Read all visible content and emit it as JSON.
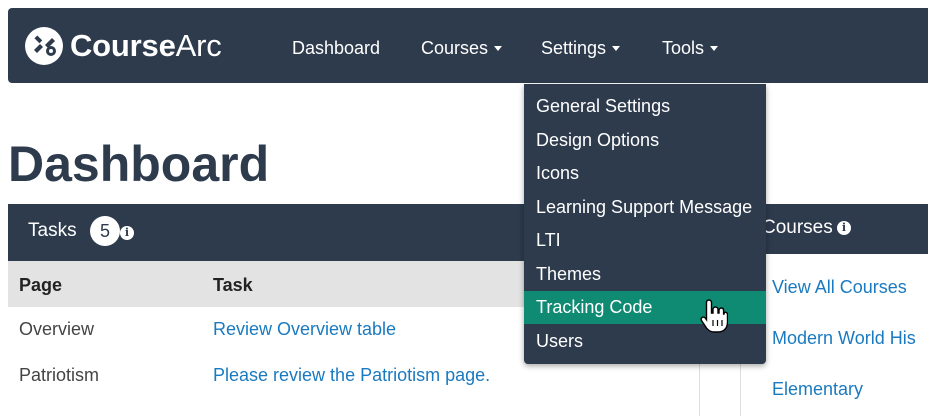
{
  "navbar": {
    "brand_bold": "Course",
    "brand_light": "Arc",
    "items": [
      {
        "label": "Dashboard"
      },
      {
        "label": "Courses"
      },
      {
        "label": "Settings"
      },
      {
        "label": "Tools"
      }
    ]
  },
  "settings_menu": {
    "items": [
      {
        "label": "General Settings"
      },
      {
        "label": "Design Options"
      },
      {
        "label": "Icons"
      },
      {
        "label": "Learning Support Message"
      },
      {
        "label": "LTI"
      },
      {
        "label": "Themes"
      },
      {
        "label": "Tracking Code",
        "active": true
      },
      {
        "label": "Users"
      }
    ]
  },
  "page": {
    "title": "Dashboard"
  },
  "tasks": {
    "title": "Tasks",
    "count": "5",
    "columns": [
      "Page",
      "Task"
    ],
    "rows": [
      {
        "page": "Overview",
        "task": "Review Overview table"
      },
      {
        "page": "Patriotism",
        "task": "Please review the Patriotism page."
      }
    ]
  },
  "courses": {
    "title": "Courses",
    "links": [
      "View All Courses",
      "Modern World His",
      "Elementary"
    ]
  },
  "colors": {
    "navbar": "#2d3b4d",
    "active_item": "#0f8a73",
    "link": "#1a7ac0"
  }
}
